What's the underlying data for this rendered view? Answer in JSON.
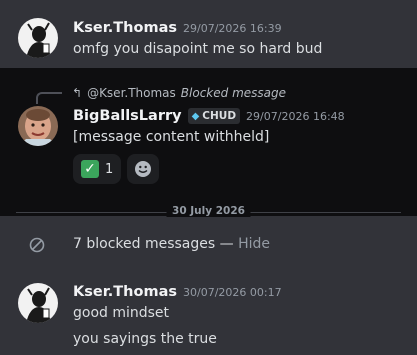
{
  "messages": [
    {
      "author": "Kser.Thomas",
      "timestamp": "29/07/2026 16:39",
      "content": "omfg you disapoint me so hard bud"
    },
    {
      "reply_to_user": "@Kser.Thomas",
      "reply_to_text": "Blocked message",
      "author": "BigBallsLarry",
      "role_badge": "CHUD",
      "timestamp": "29/07/2026 16:48",
      "content": "[message content withheld]",
      "reactions": [
        {
          "emoji": "check-mark-icon",
          "count": "1"
        }
      ]
    },
    {
      "author": "Kser.Thomas",
      "timestamp": "30/07/2026 00:17",
      "lines": [
        "good mindset",
        "you sayings the true"
      ]
    }
  ],
  "date_divider": "30 July 2026",
  "blocked": {
    "text": "7 blocked messages — ",
    "hide_label": "Hide"
  },
  "colors": {
    "background": "#323339",
    "reply_block": "#0e0e10",
    "reaction_check": "#3ba55c",
    "badge_gem": "#5ec8f0"
  }
}
